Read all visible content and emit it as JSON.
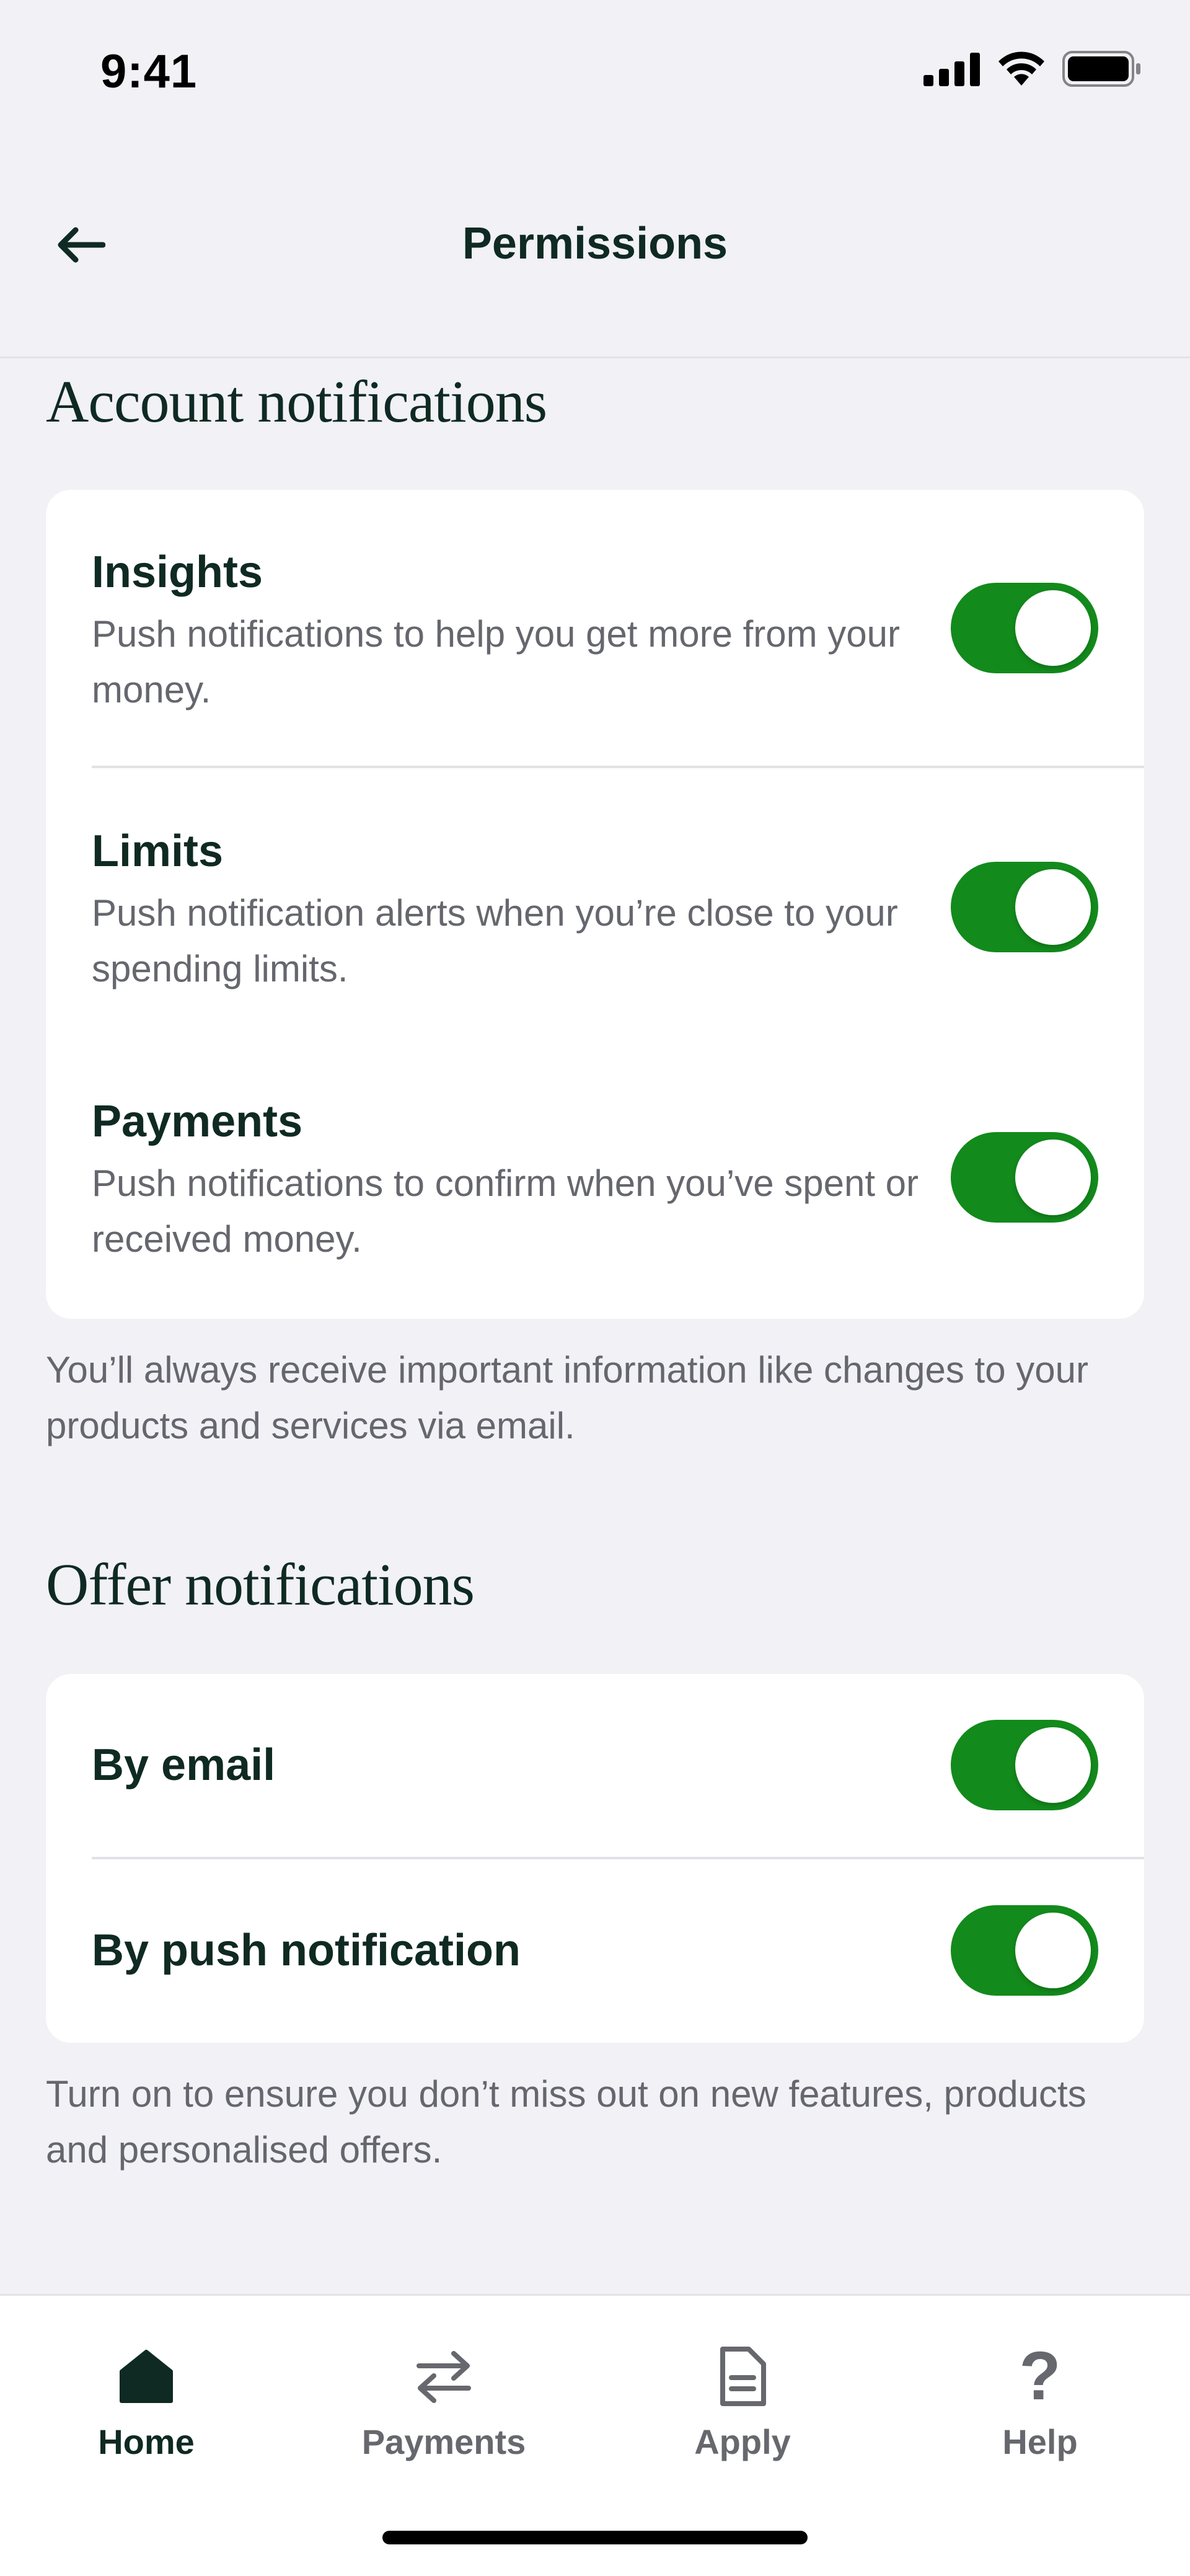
{
  "status_bar": {
    "time": "9:41"
  },
  "header": {
    "title": "Permissions"
  },
  "account_section": {
    "heading": "Account notifications",
    "items": [
      {
        "title": "Insights",
        "description": "Push notifications to help you get more from your money.",
        "enabled": true
      },
      {
        "title": "Limits",
        "description": "Push notification alerts when you’re close to your spending limits.",
        "enabled": true
      },
      {
        "title": "Payments",
        "description": "Push notifications to confirm when you’ve spent or received money.",
        "enabled": true
      }
    ],
    "footnote": "You’ll always receive important information like changes to your products and services via email."
  },
  "offer_section": {
    "heading": "Offer notifications",
    "items": [
      {
        "title": "By email",
        "enabled": true
      },
      {
        "title": "By push notification",
        "enabled": true
      }
    ],
    "footnote": "Turn on to ensure you don’t miss out on new features, products and personalised offers."
  },
  "tab_bar": {
    "tabs": [
      {
        "label": "Home",
        "icon": "home-icon",
        "active": true
      },
      {
        "label": "Payments",
        "icon": "transfer-arrows-icon",
        "active": false
      },
      {
        "label": "Apply",
        "icon": "document-icon",
        "active": false
      },
      {
        "label": "Help",
        "icon": "question-mark-icon",
        "active": false
      }
    ]
  },
  "colors": {
    "toggle_on": "#138a1c",
    "text_primary": "#0f2a22",
    "text_secondary": "#66676e",
    "background": "#f1f1f6"
  }
}
